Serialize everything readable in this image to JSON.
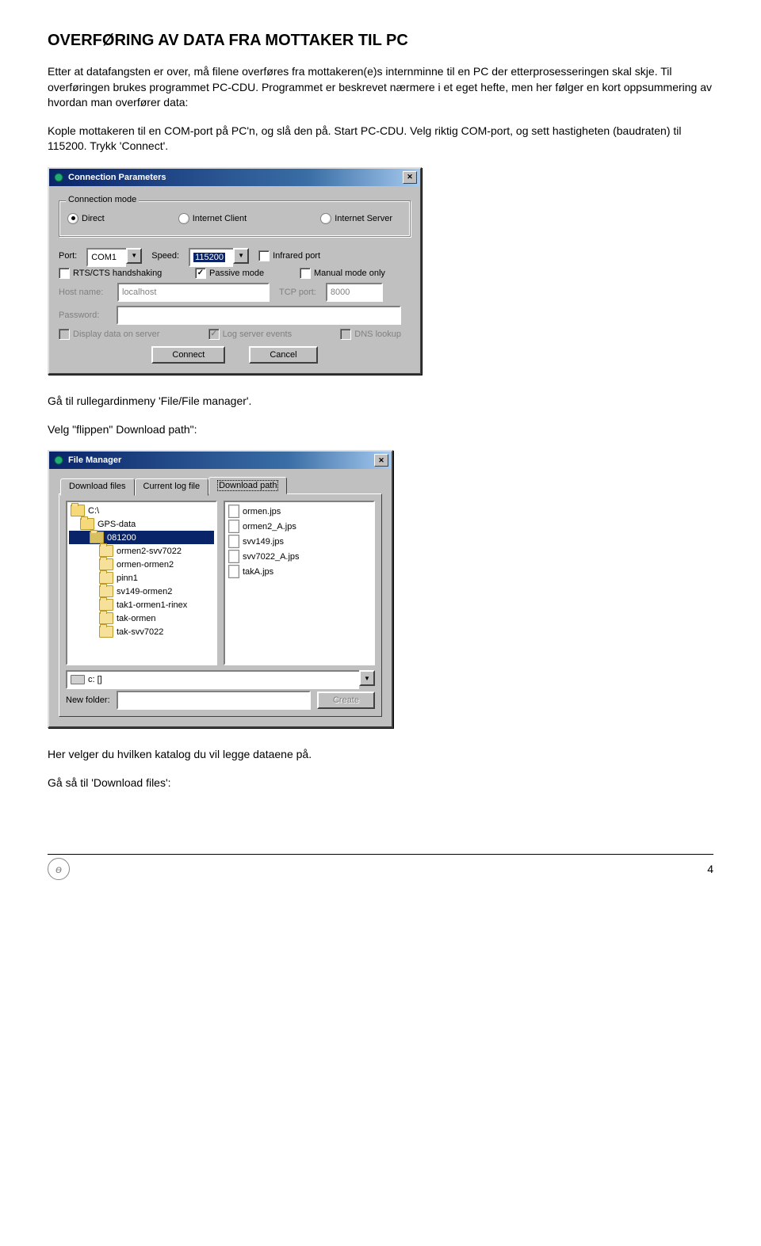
{
  "heading": "OVERFØRING AV DATA FRA MOTTAKER TIL PC",
  "intro": "Etter at datafangsten er over, må filene overføres fra mottakeren(e)s internminne til en PC der etterprosesseringen skal skje. Til overføringen brukes programmet PC-CDU. Programmet er beskrevet nærmere i et eget hefte, men her følger en kort oppsummering av hvordan man overfører data:",
  "para2": "Kople mottakeren til en COM-port på PC'n, og slå den på. Start PC-CDU. Velg riktig COM-port, og sett hastigheten (baudraten) til 115200. Trykk 'Connect'.",
  "para3": "Gå til rullegardinmeny 'File/File manager'.",
  "para4": "Velg \"flippen\" Download path\":",
  "para5": "Her velger du hvilken katalog du vil legge dataene på.",
  "para6": "Gå så til 'Download files':",
  "page": "4",
  "conn": {
    "title": "Connection Parameters",
    "group": "Connection mode",
    "modes": {
      "direct": "Direct",
      "iclient": "Internet Client",
      "iserver": "Internet Server"
    },
    "port_label": "Port:",
    "port_value": "COM1",
    "speed_label": "Speed:",
    "speed_value": "115200",
    "infrared": "Infrared port",
    "rts": "RTS/CTS handshaking",
    "passive": "Passive mode",
    "manual": "Manual mode only",
    "host_label": "Host name:",
    "host_value": "localhost",
    "tcp_label": "TCP port:",
    "tcp_value": "8000",
    "pwd_label": "Password:",
    "display": "Display data on server",
    "log": "Log server events",
    "dns": "DNS lookup",
    "connect": "Connect",
    "cancel": "Cancel"
  },
  "fm": {
    "title": "File Manager",
    "tabs": {
      "download": "Download files",
      "current": "Current log file",
      "path": "Download path"
    },
    "folders": [
      "C:\\",
      "GPS-data",
      "081200",
      "ormen2-svv7022",
      "ormen-ormen2",
      "pinn1",
      "sv149-ormen2",
      "tak1-ormen1-rinex",
      "tak-ormen",
      "tak-svv7022"
    ],
    "files": [
      "ormen.jps",
      "ormen2_A.jps",
      "svv149.jps",
      "svv7022_A.jps",
      "takA.jps"
    ],
    "drive_icon": "drive",
    "drive_value": "c: []",
    "newfolder_label": "New folder:",
    "create": "Create"
  }
}
